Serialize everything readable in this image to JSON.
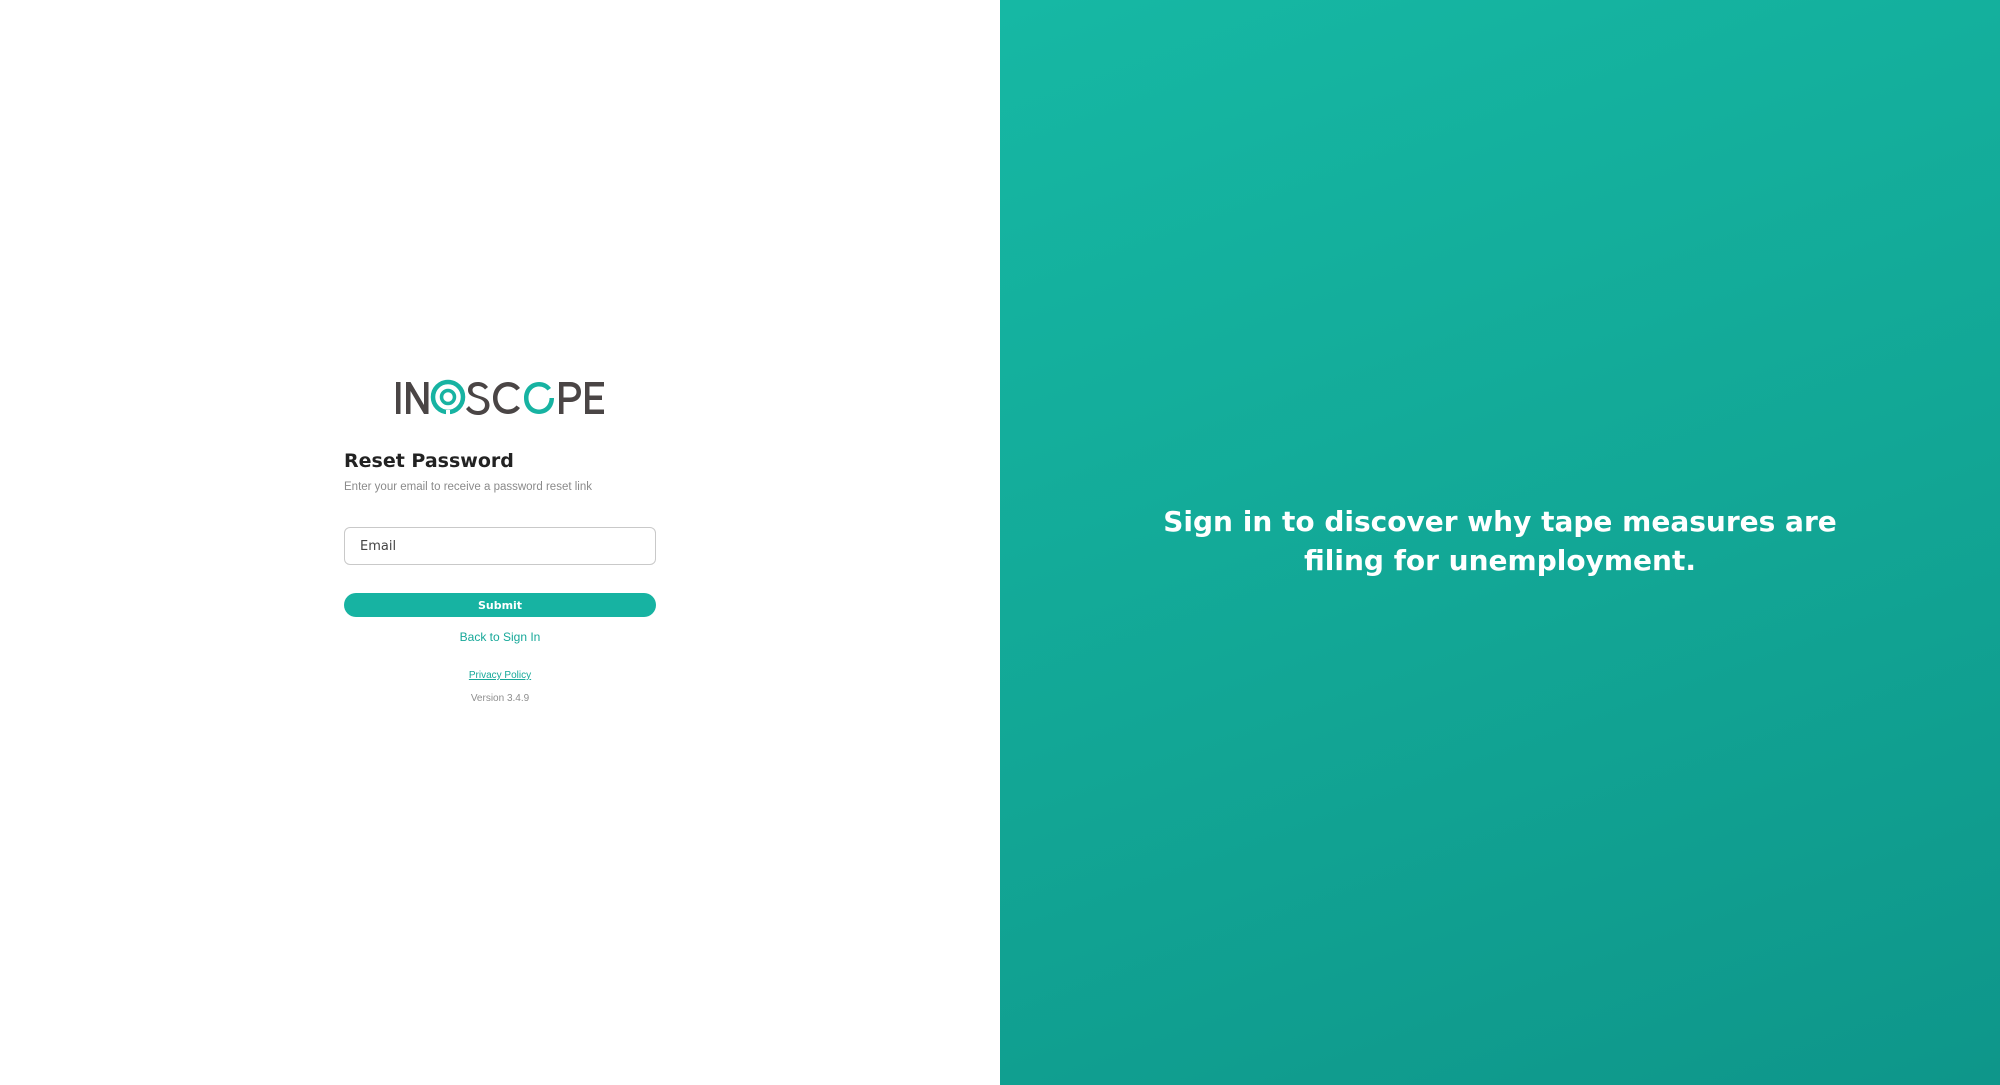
{
  "brand": {
    "logo_text": "INOSCOPE",
    "logo_dark_color": "#4a4545",
    "logo_accent_color": "#17b3a2"
  },
  "form": {
    "title": "Reset Password",
    "subtitle": "Enter your email to receive a password reset link",
    "email_placeholder": "Email",
    "email_value": "",
    "submit_label": "Submit",
    "back_link_label": "Back to Sign In"
  },
  "footer": {
    "privacy_label": "Privacy Policy",
    "version_label": "Version 3.4.9"
  },
  "hero": {
    "tagline": "Sign in to discover why tape measures are filing for unemployment.",
    "background_color": "#14b09e"
  }
}
